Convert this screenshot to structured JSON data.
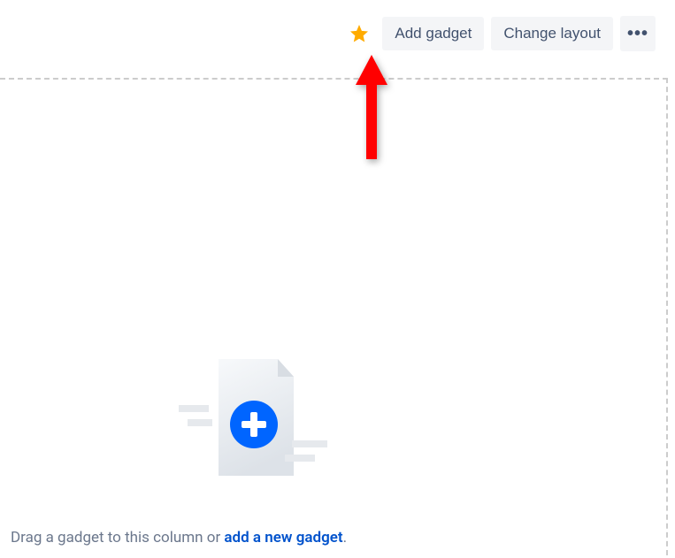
{
  "toolbar": {
    "star_icon": "star-icon",
    "add_gadget_label": "Add gadget",
    "change_layout_label": "Change layout",
    "more_label": "•••"
  },
  "empty_state": {
    "prefix_text": "Drag a gadget to this column or ",
    "link_text": "add a new gadget",
    "suffix_text": "."
  }
}
